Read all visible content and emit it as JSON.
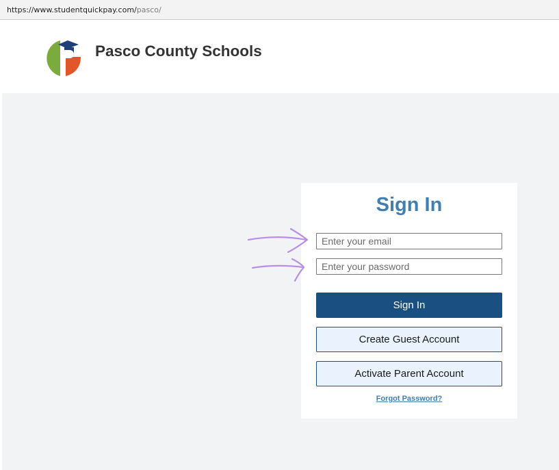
{
  "browser": {
    "url_base": "https://www.studentquickpay.com/",
    "url_path": "pasco/"
  },
  "header": {
    "logo_icon": "pasco-logo-icon",
    "title": "Pasco County Schools"
  },
  "signin": {
    "title": "Sign In",
    "email_placeholder": "Enter your email",
    "email_value": "",
    "password_placeholder": "Enter your password",
    "password_value": "",
    "signin_label": "Sign In",
    "guest_label": "Create Guest Account",
    "parent_label": "Activate Parent Account",
    "forgot_label": "Forgot Password?"
  },
  "annotations": {
    "arrow_icon": "hand-drawn-arrow-icon",
    "arrow_color": "#b98ee6"
  },
  "colors": {
    "brand_blue": "#3f7fb2",
    "button_navy": "#1a4f82",
    "button_light": "#eaf3fd",
    "page_background": "#f2f3f5",
    "logo_green": "#7cab3d",
    "logo_orange": "#e2572a",
    "logo_navy": "#1e3f7a"
  }
}
